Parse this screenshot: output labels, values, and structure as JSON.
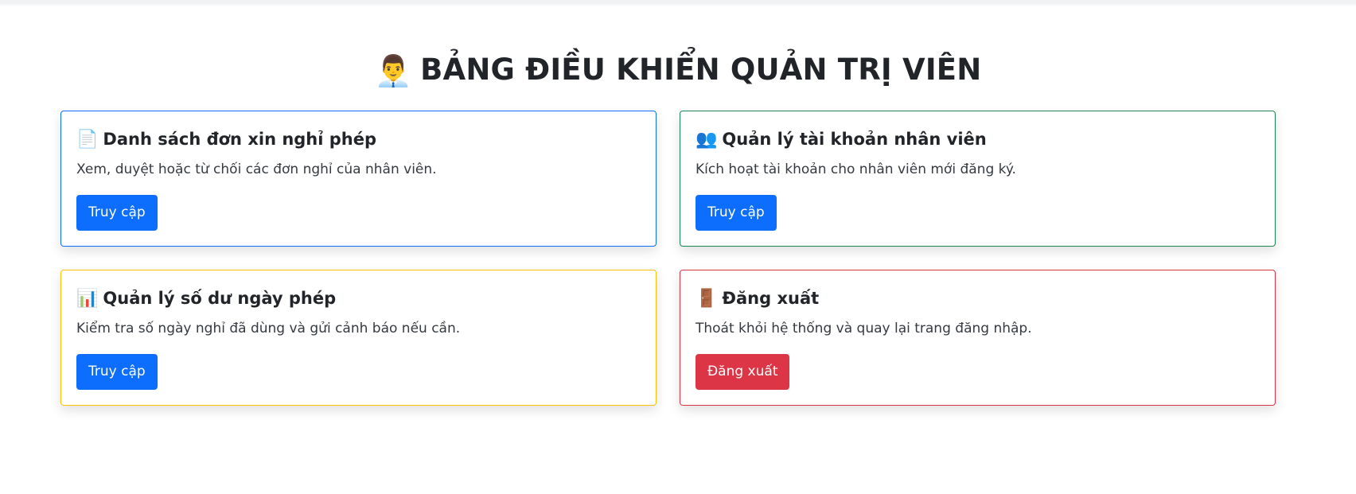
{
  "page": {
    "title_icon": "👨‍💼",
    "title": "BẢNG ĐIỀU KHIỂN QUẢN TRỊ VIÊN"
  },
  "cards": [
    {
      "icon": "📄",
      "title": "Danh sách đơn xin nghỉ phép",
      "description": "Xem, duyệt hoặc từ chối các đơn nghỉ của nhân viên.",
      "button_label": "Truy cập",
      "border_color": "#0d6efd",
      "button_color": "#0d6efd"
    },
    {
      "icon": "👥",
      "title": "Quản lý tài khoản nhân viên",
      "description": "Kích hoạt tài khoản cho nhân viên mới đăng ký.",
      "button_label": "Truy cập",
      "border_color": "#198754",
      "button_color": "#0d6efd"
    },
    {
      "icon": "📊",
      "title": "Quản lý số dư ngày phép",
      "description": "Kiểm tra số ngày nghỉ đã dùng và gửi cảnh báo nếu cần.",
      "button_label": "Truy cập",
      "border_color": "#ffc107",
      "button_color": "#0d6efd"
    },
    {
      "icon": "🚪",
      "title": "Đăng xuất",
      "description": "Thoát khỏi hệ thống và quay lại trang đăng nhập.",
      "button_label": "Đăng xuất",
      "border_color": "#dc3545",
      "button_color": "#dc3545"
    }
  ]
}
